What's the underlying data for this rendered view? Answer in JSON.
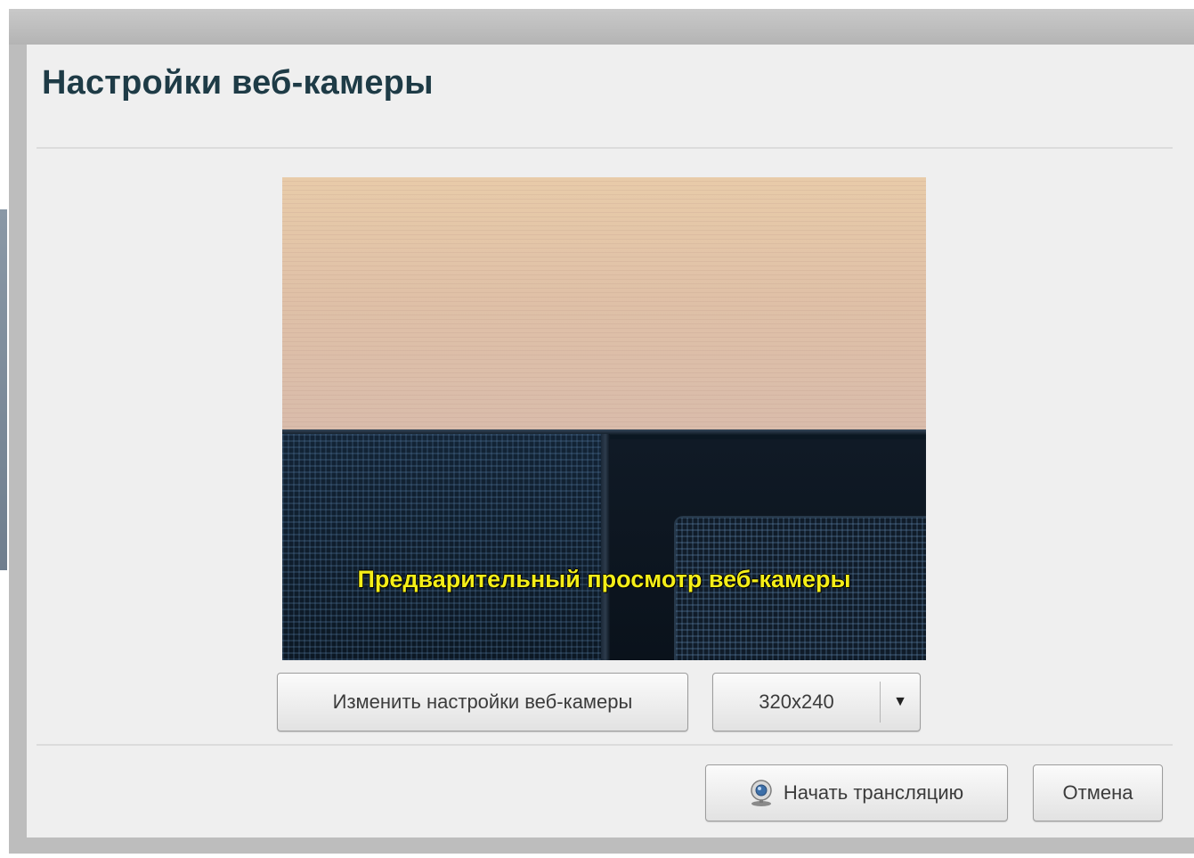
{
  "dialog": {
    "title": "Настройки веб-камеры"
  },
  "preview": {
    "caption": "Предварительный просмотр веб-камеры"
  },
  "controls": {
    "settings_button_label": "Изменить настройки веб-камеры",
    "resolution": {
      "selected": "320x240",
      "arrow": "▼"
    }
  },
  "footer": {
    "start_button_label": "Начать трансляцию",
    "start_icon": "webcam-icon",
    "cancel_button_label": "Отмена"
  }
}
